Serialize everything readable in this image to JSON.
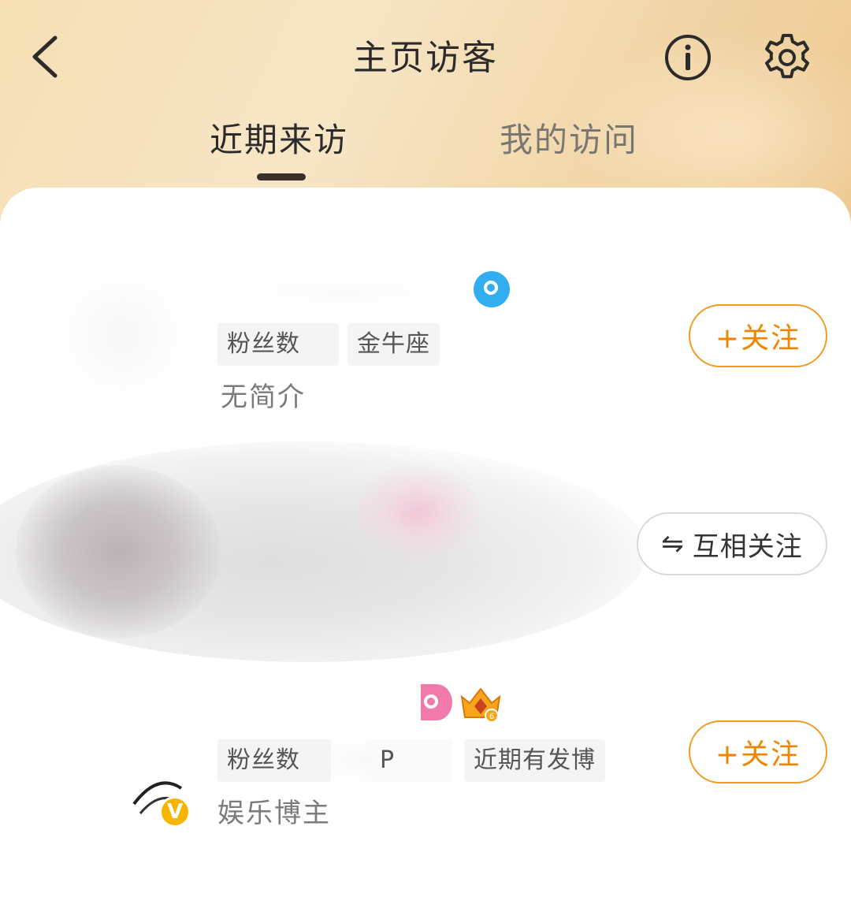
{
  "header": {
    "title": "主页访客",
    "tabs": [
      {
        "label": "近期来访",
        "active": true
      },
      {
        "label": "我的访问",
        "active": false
      }
    ]
  },
  "icons": {
    "back": "chevron-left-icon",
    "info": "info-icon",
    "settings": "gear-icon"
  },
  "colors": {
    "accent": "#f08300",
    "header_gradient_start": "#f6dfb4",
    "header_gradient_end": "#edc88f",
    "blue_badge": "#31aef0",
    "pink_badge": "#f07aaa",
    "vip_gold": "#f7b500"
  },
  "visitors": [
    {
      "tags": [
        "粉丝数",
        "金牛座"
      ],
      "bio": "无简介",
      "action": "+关注"
    },
    {
      "action_glyph": "⇋",
      "action": "互相关注"
    },
    {
      "tags": [
        "粉丝数",
        "P",
        "近期有发博"
      ],
      "bio": "娱乐博主",
      "action": "+关注",
      "verified_mark": "V"
    }
  ]
}
